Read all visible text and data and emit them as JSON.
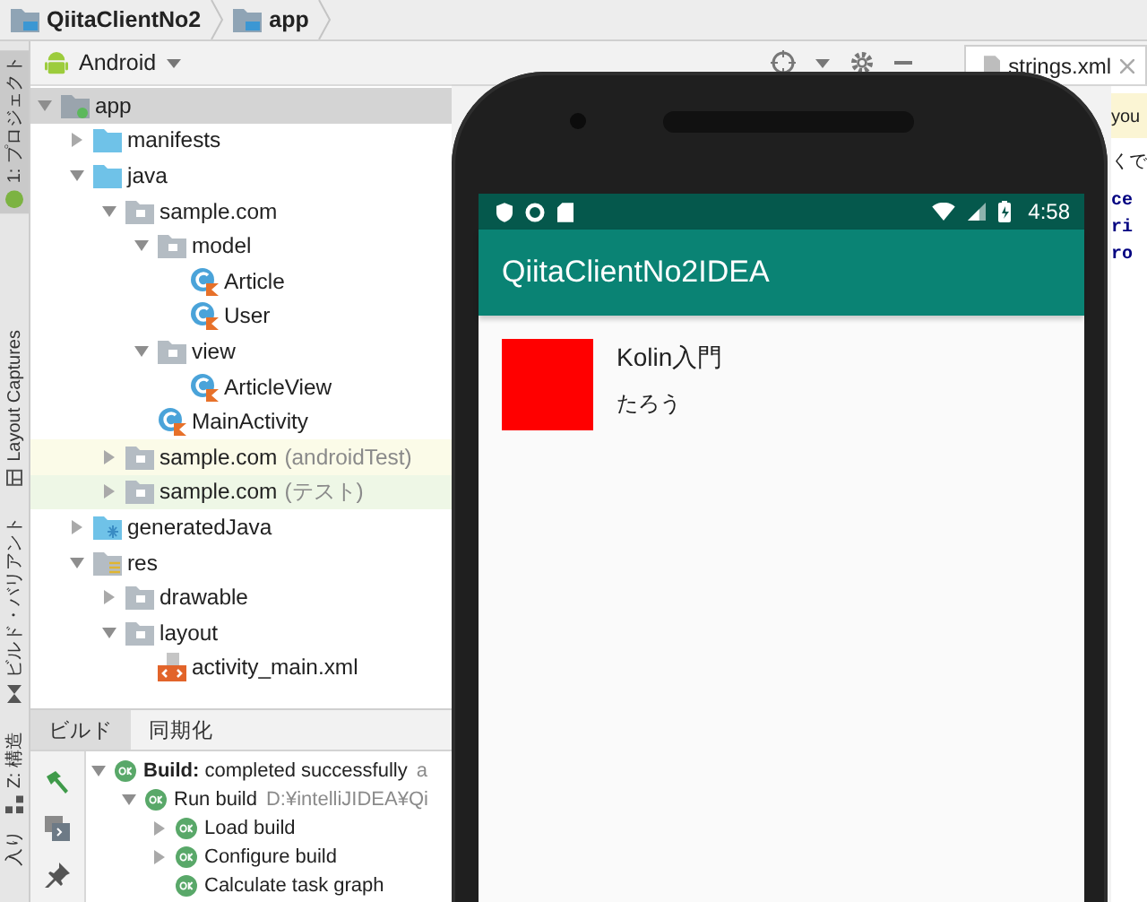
{
  "breadcrumbs": [
    {
      "label": "QiitaClientNo2"
    },
    {
      "label": "app"
    }
  ],
  "side_tabs": [
    {
      "label": "1: プロジェクト",
      "selected": true
    },
    {
      "label": "Layout Captures",
      "selected": false
    },
    {
      "label": "ビルド・バリアント",
      "selected": false
    },
    {
      "label": "Z: 構造",
      "selected": false
    },
    {
      "label": "入り",
      "selected": false
    }
  ],
  "project_view": {
    "label": "Android"
  },
  "editor_tabs": [
    {
      "label": "strings.xml"
    }
  ],
  "editor": {
    "banner": "you",
    "hint": "くで",
    "code_lines": [
      "ce",
      "ri",
      "ro"
    ]
  },
  "project_tree": [
    {
      "kind": "module",
      "label": "app",
      "expanded": true,
      "selected": true,
      "children": [
        {
          "kind": "folder",
          "label": "manifests",
          "expanded": false,
          "selected": false
        },
        {
          "kind": "folder",
          "label": "java",
          "expanded": true,
          "selected": false,
          "children": [
            {
              "kind": "package",
              "label": "sample.com",
              "expanded": true,
              "selected": false,
              "children": [
                {
                  "kind": "package",
                  "label": "model",
                  "expanded": true,
                  "selected": false,
                  "children": [
                    {
                      "kind": "class",
                      "label": "Article",
                      "selected": false
                    },
                    {
                      "kind": "class",
                      "label": "User",
                      "selected": false
                    }
                  ]
                },
                {
                  "kind": "package",
                  "label": "view",
                  "expanded": true,
                  "selected": false,
                  "children": [
                    {
                      "kind": "class",
                      "label": "ArticleView",
                      "selected": false
                    }
                  ]
                },
                {
                  "kind": "class",
                  "label": "MainActivity",
                  "selected": false
                }
              ]
            },
            {
              "kind": "package",
              "label": "sample.com",
              "suffix": "(androidTest)",
              "expanded": false,
              "selected": false,
              "color": "#fbfbe8"
            },
            {
              "kind": "package",
              "label": "sample.com",
              "suffix": "(テスト)",
              "expanded": false,
              "selected": false,
              "color": "#eef7e6"
            }
          ]
        },
        {
          "kind": "generated",
          "label": "generatedJava",
          "expanded": false,
          "selected": false
        },
        {
          "kind": "res",
          "label": "res",
          "expanded": true,
          "selected": false,
          "children": [
            {
              "kind": "package",
              "label": "drawable",
              "expanded": false,
              "selected": false
            },
            {
              "kind": "package",
              "label": "layout",
              "expanded": true,
              "selected": false,
              "children": [
                {
                  "kind": "xml",
                  "label": "activity_main.xml",
                  "selected": false
                }
              ]
            }
          ]
        }
      ]
    }
  ],
  "build_tabs": [
    {
      "label": "ビルド",
      "selected": true
    },
    {
      "label": "同期化",
      "selected": false
    }
  ],
  "build_tree": [
    {
      "label": "**Build:** completed successfully",
      "detail": "a",
      "expanded": true,
      "children": [
        {
          "label": "Run build",
          "detail": "D:¥intelliJIDEA¥Qi",
          "expanded": true,
          "children": [
            {
              "label": "Load build",
              "expanded": false
            },
            {
              "label": "Configure build",
              "expanded": false
            },
            {
              "label": "Calculate task graph"
            }
          ]
        }
      ]
    }
  ],
  "emulator": {
    "status_time": "4:58",
    "app_title": "QiitaClientNo2IDEA",
    "articles": [
      {
        "title": "Kolin入門",
        "author": "たろう",
        "color": "#ff0000"
      }
    ]
  }
}
